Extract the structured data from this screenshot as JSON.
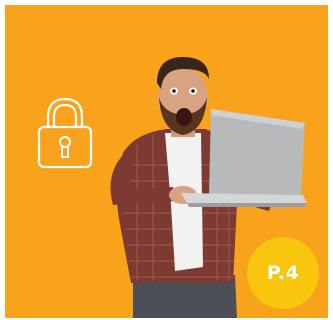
{
  "badge": {
    "label": "P.4"
  },
  "icons": {
    "lock": "lock-icon"
  },
  "colors": {
    "background": "#f9a31c",
    "badge": "#f7c60d",
    "badge_text": "#ffffff",
    "lock_outline": "#ffffff"
  }
}
